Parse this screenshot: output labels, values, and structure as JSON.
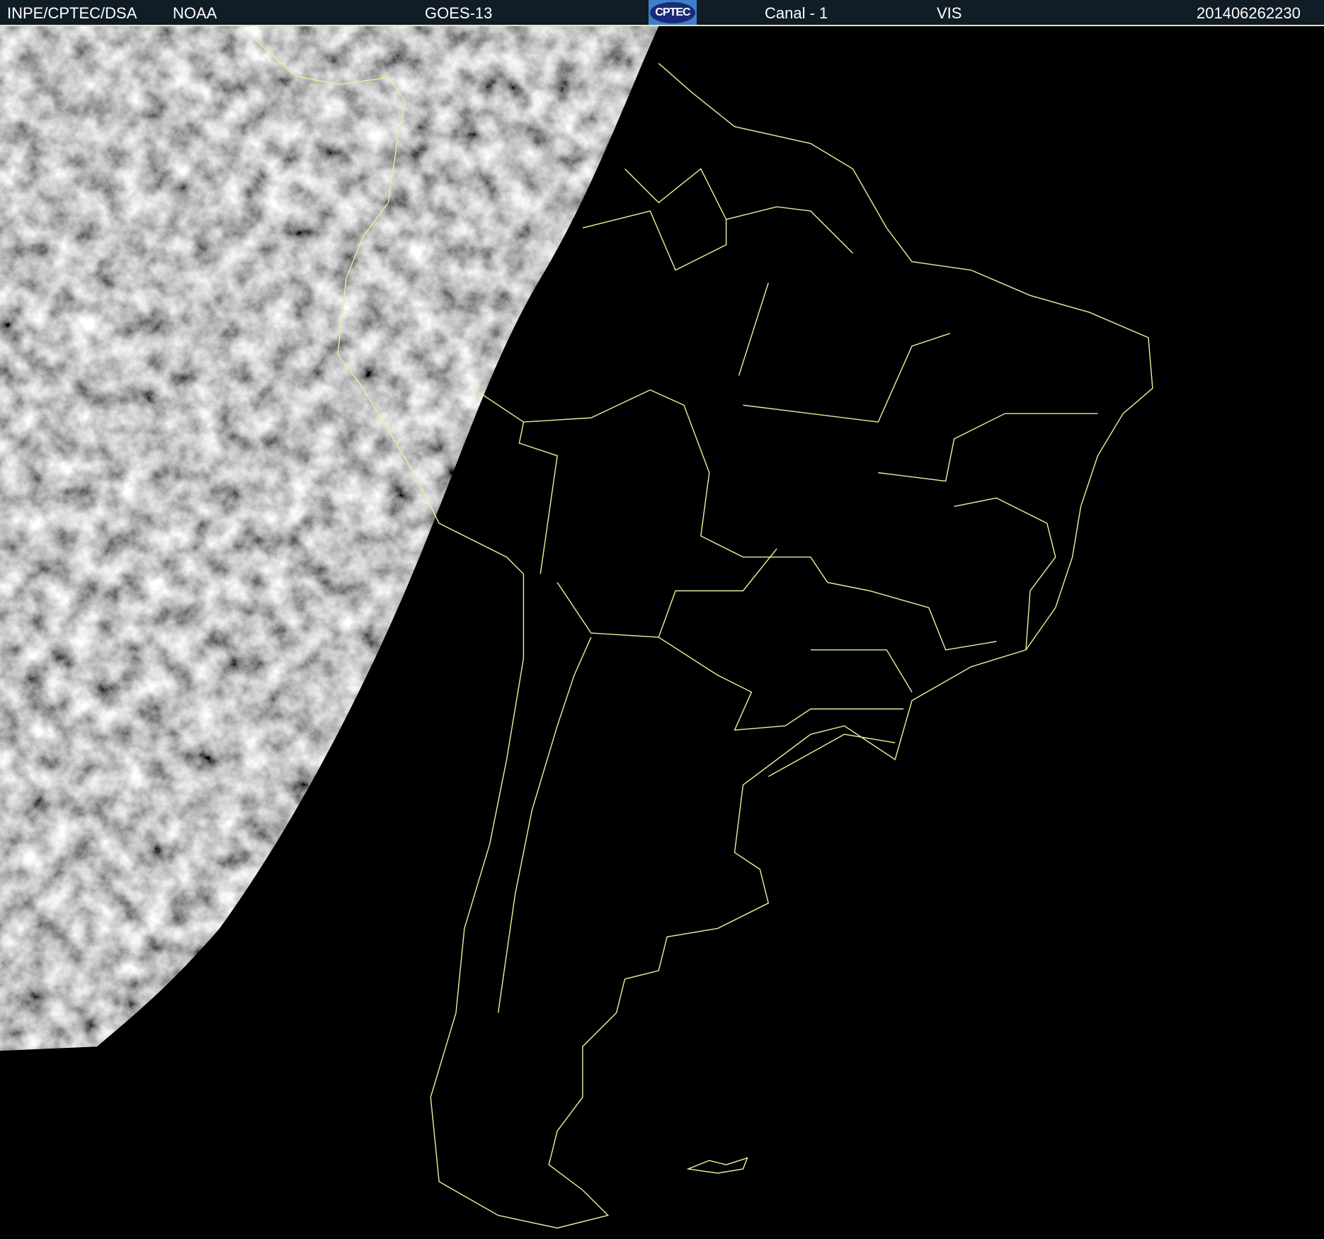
{
  "header": {
    "source": "INPE/CPTEC/DSA",
    "agency": "NOAA",
    "satellite": "GOES-13",
    "logo_text": "CPTEC",
    "channel": "Canal - 1",
    "band": "VIS",
    "timestamp": "201406262230"
  },
  "colors": {
    "header_bg": "#101c26",
    "border_lines": "#e8e8a8",
    "logo_bg": "#3f7fc8",
    "night_bg": "#000000"
  }
}
